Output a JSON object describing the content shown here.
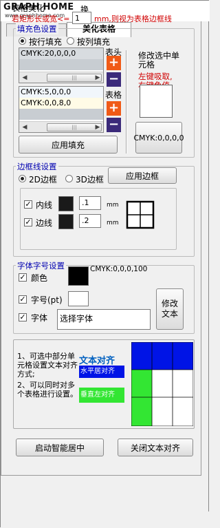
{
  "titlebar": {
    "logo": "GRAPH HOME",
    "logo_sub": "www.graphhome.com",
    "extra_char": "换"
  },
  "tabs": [
    {
      "label": "创建表格"
    },
    {
      "label": "美化表格"
    }
  ],
  "beautify": {
    "section_title": "表格美化",
    "border_rule_prefix": "若矩形长或宽<=",
    "border_rule_value": "1",
    "border_rule_suffix": "mm,则视为表格边框线"
  },
  "fill": {
    "title": "填充色设置",
    "radio_row": "按行填充",
    "radio_col": "按列填充",
    "header_label": "表头",
    "body_label": "表格",
    "header_items": [
      "CMYK:20,0,0,0"
    ],
    "body_items": [
      "CMYK:5,0,0,0",
      "CMYK:0,0,8,0"
    ],
    "apply_button": "应用填充",
    "pick_title": "修改选中单元格",
    "pick_hint": "左键吸取,右键色值",
    "pick_value": "CMYK:0,0,0,0",
    "header_colors": [
      "#d8dce0"
    ],
    "body_colors": [
      "#f1f6fb",
      "#fffbe6"
    ]
  },
  "border": {
    "title": "边框线设置",
    "radio_2d": "2D边框",
    "radio_3d": "3D边框",
    "apply_button": "应用边框",
    "inner_label": "内线",
    "inner_width": ".1",
    "outer_label": "边线",
    "outer_width": ".2",
    "unit": "mm"
  },
  "font": {
    "title": "字体字号设置",
    "color_label": "颜色",
    "color_value": "CMYK:0,0,0,100",
    "size_label": "字号(pt)",
    "size_value": "",
    "face_label": "字体",
    "face_value": "选择字体",
    "modify_button": "修改文本"
  },
  "align": {
    "tip1": "1、可选中部分单元格设置文本对齐方式;",
    "tip2": "2、可以同时对多个表格进行设置。",
    "title": "文本对齐",
    "h_label": "水平居对齐",
    "v_label": "垂直左对齐"
  },
  "footer": {
    "smart_center": "启动智能居中",
    "close_align": "关闭文本对齐"
  },
  "colors": {
    "title_blue": "#0000b0",
    "hint_red": "#d00000",
    "grid_blue": "#0014e6",
    "grid_green": "#33e633"
  }
}
